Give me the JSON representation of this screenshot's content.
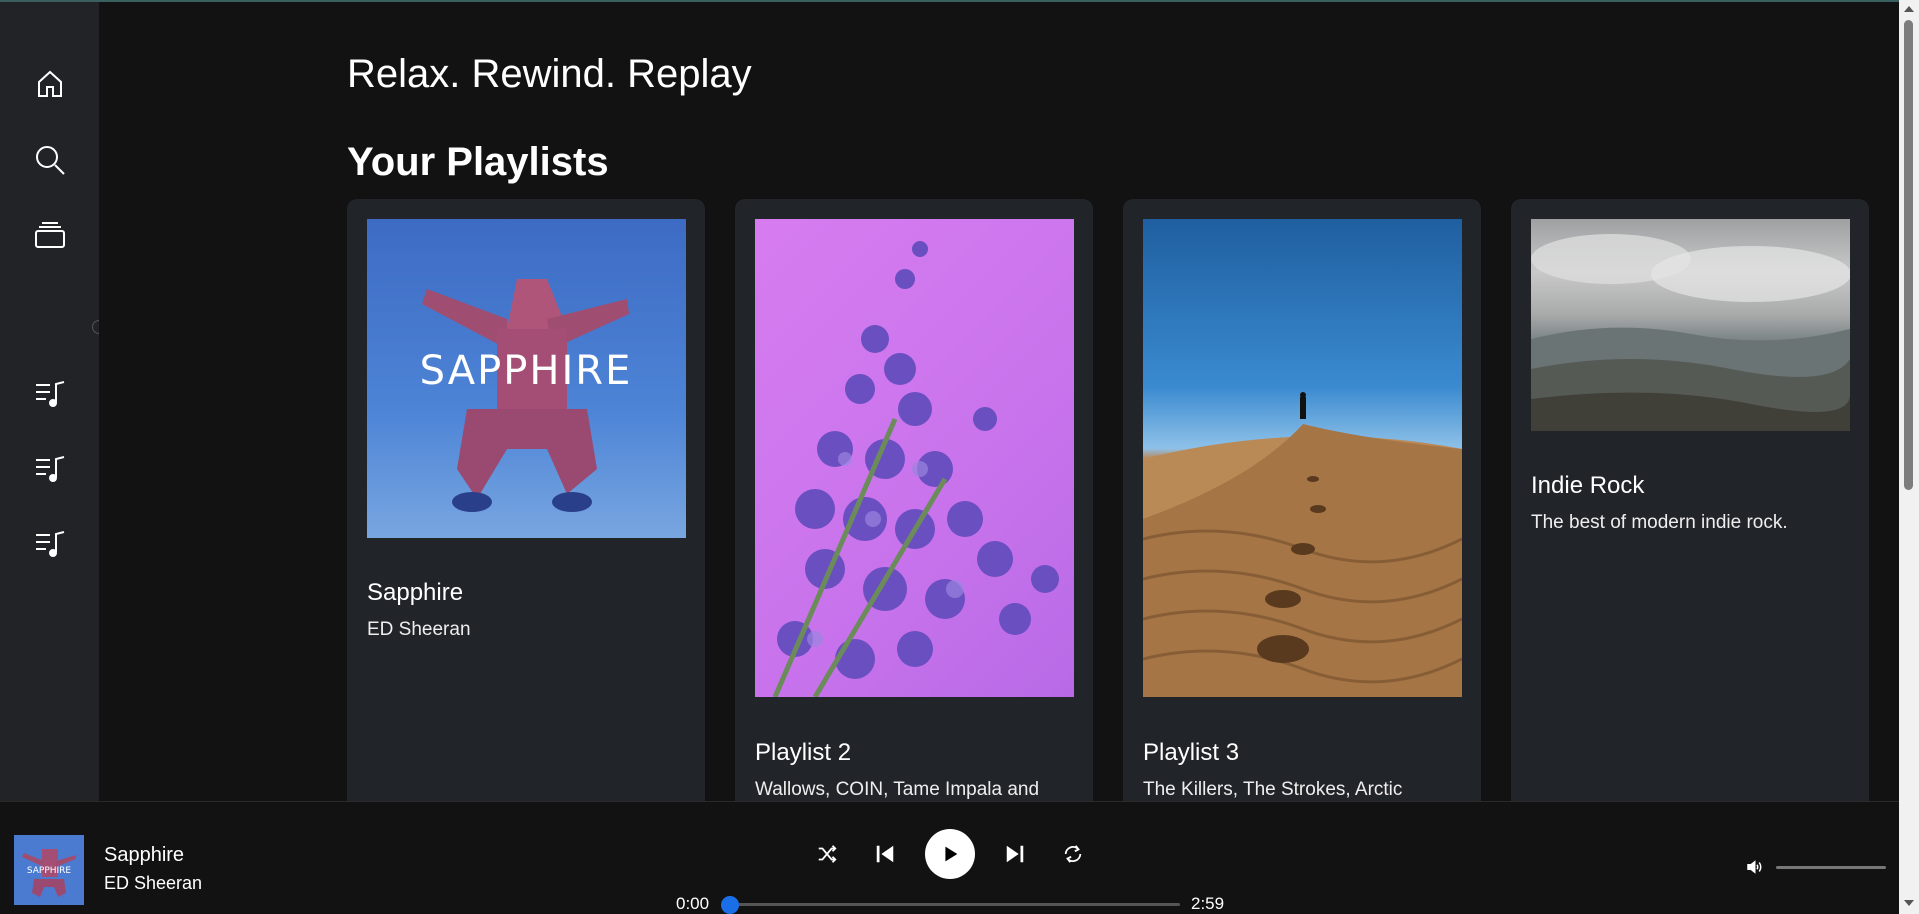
{
  "page": {
    "title": "Relax. Rewind. Replay",
    "section_title": "Your Playlists"
  },
  "sidebar": {
    "items": [
      {
        "name": "home-icon"
      },
      {
        "name": "search-icon"
      },
      {
        "name": "library-icon"
      },
      {
        "name": "playlist-icon"
      },
      {
        "name": "playlist-icon"
      },
      {
        "name": "playlist-icon"
      }
    ]
  },
  "playlists": [
    {
      "name": "Sapphire",
      "desc": "ED Sheeran",
      "art": "sapphire-cover"
    },
    {
      "name": "Playlist 2",
      "desc": "Wallows, COIN, Tame Impala and",
      "art": "lavender-flowers"
    },
    {
      "name": "Playlist 3",
      "desc": "The Killers, The Strokes, Arctic",
      "art": "desert-dune"
    },
    {
      "name": "Indie Rock",
      "desc": "The best of modern indie rock.",
      "art": "mountain-landscape"
    }
  ],
  "player": {
    "track": "Sapphire",
    "artist": "ED Sheeran",
    "current_time": "0:00",
    "duration": "2:59",
    "progress": 0.0,
    "volume": 1.0
  },
  "colors": {
    "accent": "#1a6fe8",
    "sidebar_bg": "#212327",
    "card_bg": "#212429",
    "main_bg": "#121212"
  }
}
